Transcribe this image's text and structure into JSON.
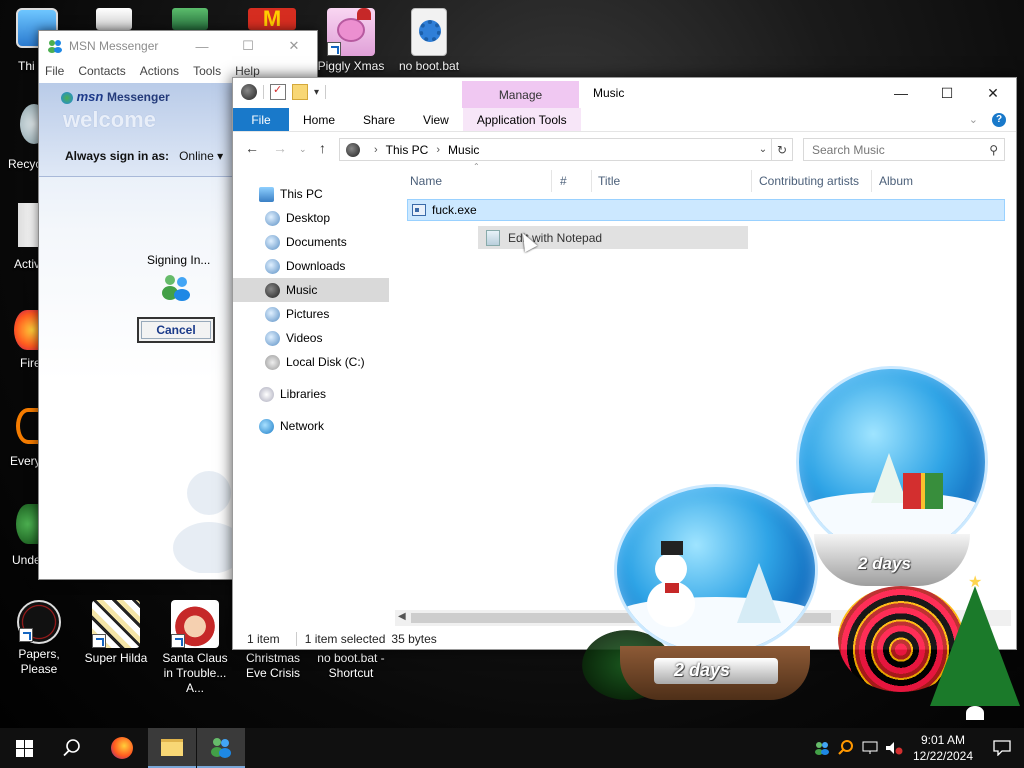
{
  "desktop": {
    "icons_top": [
      {
        "label": "Piggly Xmas"
      },
      {
        "label": "no boot.bat"
      }
    ],
    "icons_bottom": [
      {
        "label": "Papers, Please"
      },
      {
        "label": "Super Hilda"
      },
      {
        "label": "Santa Claus in Trouble... A..."
      },
      {
        "label": "Christmas Eve Crisis"
      },
      {
        "label": "no boot.bat - Shortcut"
      }
    ],
    "edge_labels": [
      "Thi",
      "Recyc",
      "Activ",
      "Fire",
      "Every",
      "Unde"
    ],
    "snowglobe_label": "2 days"
  },
  "msn": {
    "title": "MSN Messenger",
    "menu": [
      "File",
      "Contacts",
      "Actions",
      "Tools",
      "Help"
    ],
    "logo_msn": "msn",
    "logo_messenger": "Messenger",
    "welcome": "welcome",
    "sign_in_label": "Always sign in as:",
    "sign_in_status": "Online",
    "signing_in": "Signing In...",
    "cancel": "Cancel"
  },
  "explorer": {
    "title": "Music",
    "manage_tab": "Manage",
    "ribbon_tabs": [
      "File",
      "Home",
      "Share",
      "View",
      "Application Tools"
    ],
    "breadcrumb": [
      "This PC",
      "Music"
    ],
    "search_placeholder": "Search Music",
    "nav": {
      "this_pc": "This PC",
      "items": [
        "Desktop",
        "Documents",
        "Downloads",
        "Music",
        "Pictures",
        "Videos",
        "Local Disk (C:)"
      ],
      "libraries": "Libraries",
      "network": "Network"
    },
    "columns": [
      "Name",
      "#",
      "Title",
      "Contributing artists",
      "Album"
    ],
    "file": {
      "name": "fuck.exe"
    },
    "drag_action": "Edit with Notepad",
    "status": {
      "count": "1 item",
      "selected": "1 item selected",
      "size": "35 bytes"
    }
  },
  "taskbar": {
    "time": "9:01 AM",
    "date": "12/22/2024"
  },
  "colors": {
    "accent": "#1979ca",
    "manage_tab": "#f0c8f2",
    "selection": "#cce8ff"
  }
}
